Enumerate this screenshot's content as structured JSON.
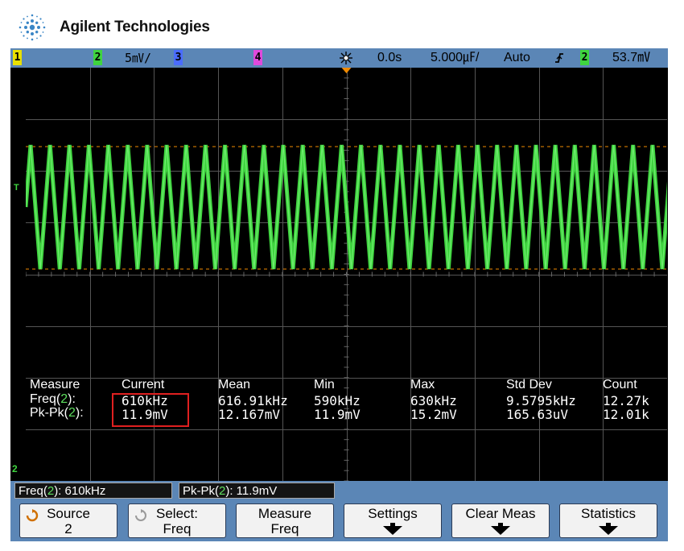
{
  "brand": {
    "name": "Agilent Technologies",
    "logo_icon": "agilent-spark-logo"
  },
  "topbar": {
    "ch1": "1",
    "ch2": "2",
    "ch2_scale": "5㎷/",
    "ch3": "3",
    "ch4": "4",
    "trigger_icon": "trigger-spark-icon",
    "time_delay": "0.0s",
    "time_scale": "5.000㎌/",
    "trigger_mode": "Auto",
    "edge_icon": "rising-edge-icon",
    "trig_source": "2",
    "trig_level": "53.7㎷",
    "colors": {
      "ch1": "#e8e000",
      "ch2": "#3fd43f",
      "ch3": "#4a6cff",
      "ch4": "#e04adc",
      "bar": "#5b86b6"
    }
  },
  "markers": {
    "trigger_level": "T",
    "ch2_ground": "2"
  },
  "measure": {
    "headers": [
      "Measure",
      "Current",
      "Mean",
      "Min",
      "Max",
      "Std Dev",
      "Count"
    ],
    "rows": [
      {
        "name": "Freq(",
        "src": "2",
        "suffix": "):",
        "values": [
          "610kHz",
          "616.91kHz",
          "590kHz",
          "630kHz",
          "9.5795kHz",
          "12.27k"
        ]
      },
      {
        "name": "Pk-Pk(",
        "src": "2",
        "suffix": "):",
        "values": [
          "11.9mV",
          "12.167mV",
          "11.9mV",
          "15.2mV",
          "165.63uV",
          "12.01k"
        ]
      }
    ]
  },
  "status": {
    "freq": {
      "prefix": "Freq(",
      "src": "2",
      "suffix": "): 610kHz"
    },
    "pkpk": {
      "prefix": "Pk-Pk(",
      "src": "2",
      "suffix": "): 11.9mV"
    }
  },
  "softkeys": [
    {
      "line1": "Source",
      "line2": "2",
      "icon": "knob-icon"
    },
    {
      "line1": "Select:",
      "line2": "Freq",
      "icon": "knob-icon"
    },
    {
      "line1": "Measure",
      "line2": "Freq"
    },
    {
      "line1": "Settings",
      "icon": "down-arrow-icon"
    },
    {
      "line1": "Clear Meas",
      "icon": "down-arrow-icon"
    },
    {
      "line1": "Statistics",
      "icon": "down-arrow-icon"
    }
  ],
  "waveform": {
    "color": "#3fd43f",
    "cycles": 33
  }
}
